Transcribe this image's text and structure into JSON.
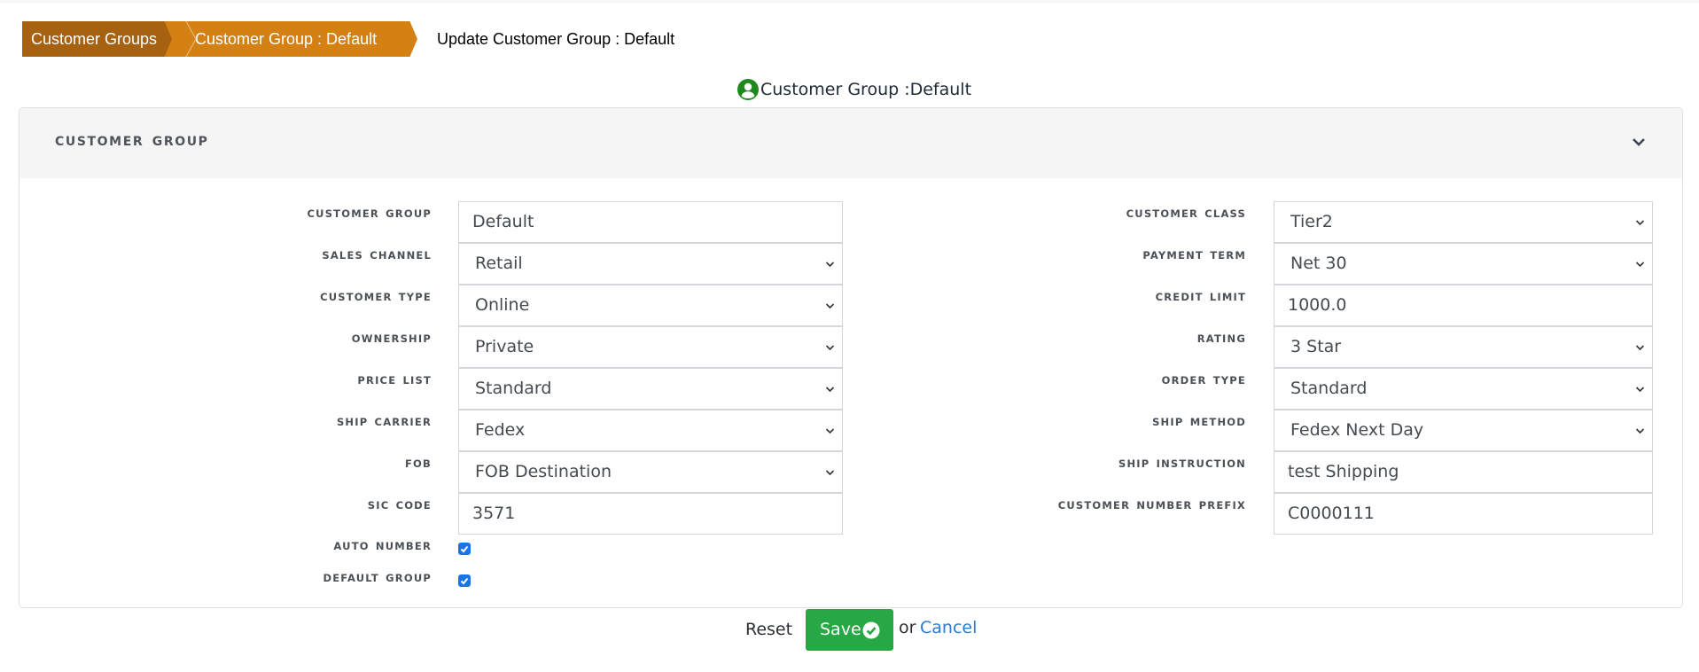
{
  "breadcrumb": {
    "items": [
      {
        "label": "Customer Groups"
      },
      {
        "label": "Customer Group : Default"
      }
    ],
    "current": "Update Customer Group : Default",
    "colors": {
      "first": "#a66211",
      "second": "#d48013"
    }
  },
  "page_title": {
    "icon": "user-circle-icon",
    "text": "Customer Group :Default",
    "icon_color": "#1e8a1e"
  },
  "panel": {
    "title": "CUSTOMER GROUP",
    "collapse_icon": "chevron-down-icon"
  },
  "form": {
    "left": [
      {
        "label": "CUSTOMER GROUP",
        "type": "text",
        "value": "Default"
      },
      {
        "label": "SALES CHANNEL",
        "type": "select",
        "value": "Retail"
      },
      {
        "label": "CUSTOMER TYPE",
        "type": "select",
        "value": "Online"
      },
      {
        "label": "OWNERSHIP",
        "type": "select",
        "value": "Private"
      },
      {
        "label": "PRICE LIST",
        "type": "select",
        "value": "Standard"
      },
      {
        "label": "SHIP CARRIER",
        "type": "select",
        "value": "Fedex"
      },
      {
        "label": "FOB",
        "type": "select",
        "value": "FOB Destination"
      },
      {
        "label": "SIC CODE",
        "type": "text",
        "value": "3571"
      }
    ],
    "right": [
      {
        "label": "CUSTOMER CLASS",
        "type": "select",
        "value": "Tier2"
      },
      {
        "label": "PAYMENT TERM",
        "type": "select",
        "value": "Net 30"
      },
      {
        "label": "CREDIT LIMIT",
        "type": "text",
        "value": "1000.0"
      },
      {
        "label": "RATING",
        "type": "select",
        "value": "3 Star"
      },
      {
        "label": "ORDER TYPE",
        "type": "select",
        "value": "Standard"
      },
      {
        "label": "SHIP METHOD",
        "type": "select",
        "value": "Fedex Next Day"
      },
      {
        "label": "SHIP INSTRUCTION",
        "type": "text",
        "value": "test Shipping"
      },
      {
        "label": "CUSTOMER NUMBER PREFIX",
        "type": "text",
        "value": "C0000111"
      }
    ],
    "checkboxes": [
      {
        "label": "AUTO NUMBER",
        "checked": true
      },
      {
        "label": "DEFAULT GROUP",
        "checked": true
      }
    ]
  },
  "actions": {
    "reset_label": "Reset",
    "save_label": "Save",
    "save_icon": "check-circle-icon",
    "or_text": "or",
    "cancel_label": "Cancel",
    "save_color": "#28a745",
    "link_color": "#2b7bd6"
  }
}
